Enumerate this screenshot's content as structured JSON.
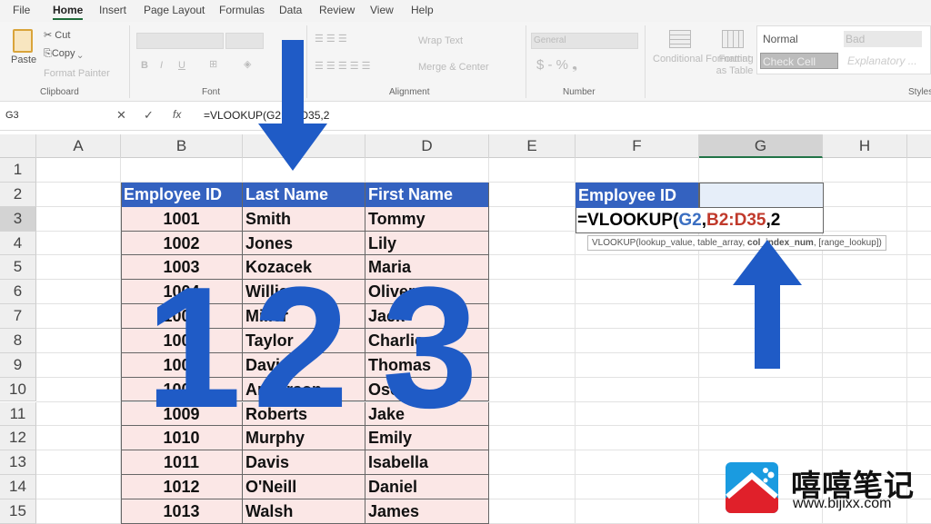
{
  "menu": [
    "File",
    "Home",
    "Insert",
    "Page Layout",
    "Formulas",
    "Data",
    "Review",
    "View",
    "Help"
  ],
  "ribbon": {
    "paste": "Paste",
    "cut": "Cut",
    "copy": "Copy",
    "format_painter": "Format Painter",
    "clipboard": "Clipboard",
    "font": "Font",
    "alignment": "Alignment",
    "number": "Number",
    "styles": "Styles",
    "wrap_text": "Wrap Text",
    "merge_center": "Merge & Center",
    "number_format": "General",
    "conditional_formatting": "Conditional Formatting",
    "format_as_table": "Format as Table",
    "style_normal": "Normal",
    "style_bad": "Bad",
    "style_check_cell": "Check Cell",
    "style_explanatory": "Explanatory ..."
  },
  "formula_bar": {
    "name_box": "G3",
    "formula": "=VLOOKUP(G2,B2:D35,2"
  },
  "columns": [
    "A",
    "B",
    "C",
    "D",
    "E",
    "F",
    "G",
    "H"
  ],
  "rows": [
    "1",
    "2",
    "3",
    "4",
    "5",
    "6",
    "7",
    "8",
    "9",
    "10",
    "11",
    "12",
    "13",
    "14",
    "15"
  ],
  "table": {
    "headers": [
      "Employee ID",
      "Last Name",
      "First Name"
    ],
    "rows": [
      [
        "1001",
        "Smith",
        "Tommy"
      ],
      [
        "1002",
        "Jones",
        "Lily"
      ],
      [
        "1003",
        "Kozacek",
        "Maria"
      ],
      [
        "1004",
        "Williams",
        "Oliver"
      ],
      [
        "1005",
        "Miller",
        "Jack"
      ],
      [
        "1006",
        "Taylor",
        "Charlie"
      ],
      [
        "1007",
        "Davis",
        "Thomas"
      ],
      [
        "1008",
        "Anderson",
        "Oscar"
      ],
      [
        "1009",
        "Roberts",
        "Jake"
      ],
      [
        "1010",
        "Murphy",
        "Emily"
      ],
      [
        "1011",
        "Davis",
        "Isabella"
      ],
      [
        "1012",
        "O'Neill",
        "Daniel"
      ],
      [
        "1013",
        "Walsh",
        "James"
      ]
    ]
  },
  "lookup": {
    "label": "Employee ID",
    "formula_prefix": "=VLOOKUP(",
    "arg1": "G2",
    "sep": ",",
    "arg2": "B2:D35",
    "tail": ",2",
    "tooltip_pre": "VLOOKUP(lookup_value, table_array, ",
    "tooltip_bold": "col_index_num",
    "tooltip_post": ", [range_lookup])"
  },
  "overlay": {
    "digit1": "1",
    "digit2": "2",
    "digit3": "3",
    "arrow_color": "#1f5bc6"
  },
  "watermark": {
    "title": "嘻嘻笔记",
    "url": "www.bijixx.com"
  },
  "colors": {
    "header_fill": "#3462c0",
    "table_fill": "#fbe7e6",
    "ref1": "#3b6fc2",
    "ref2": "#c0392b"
  }
}
